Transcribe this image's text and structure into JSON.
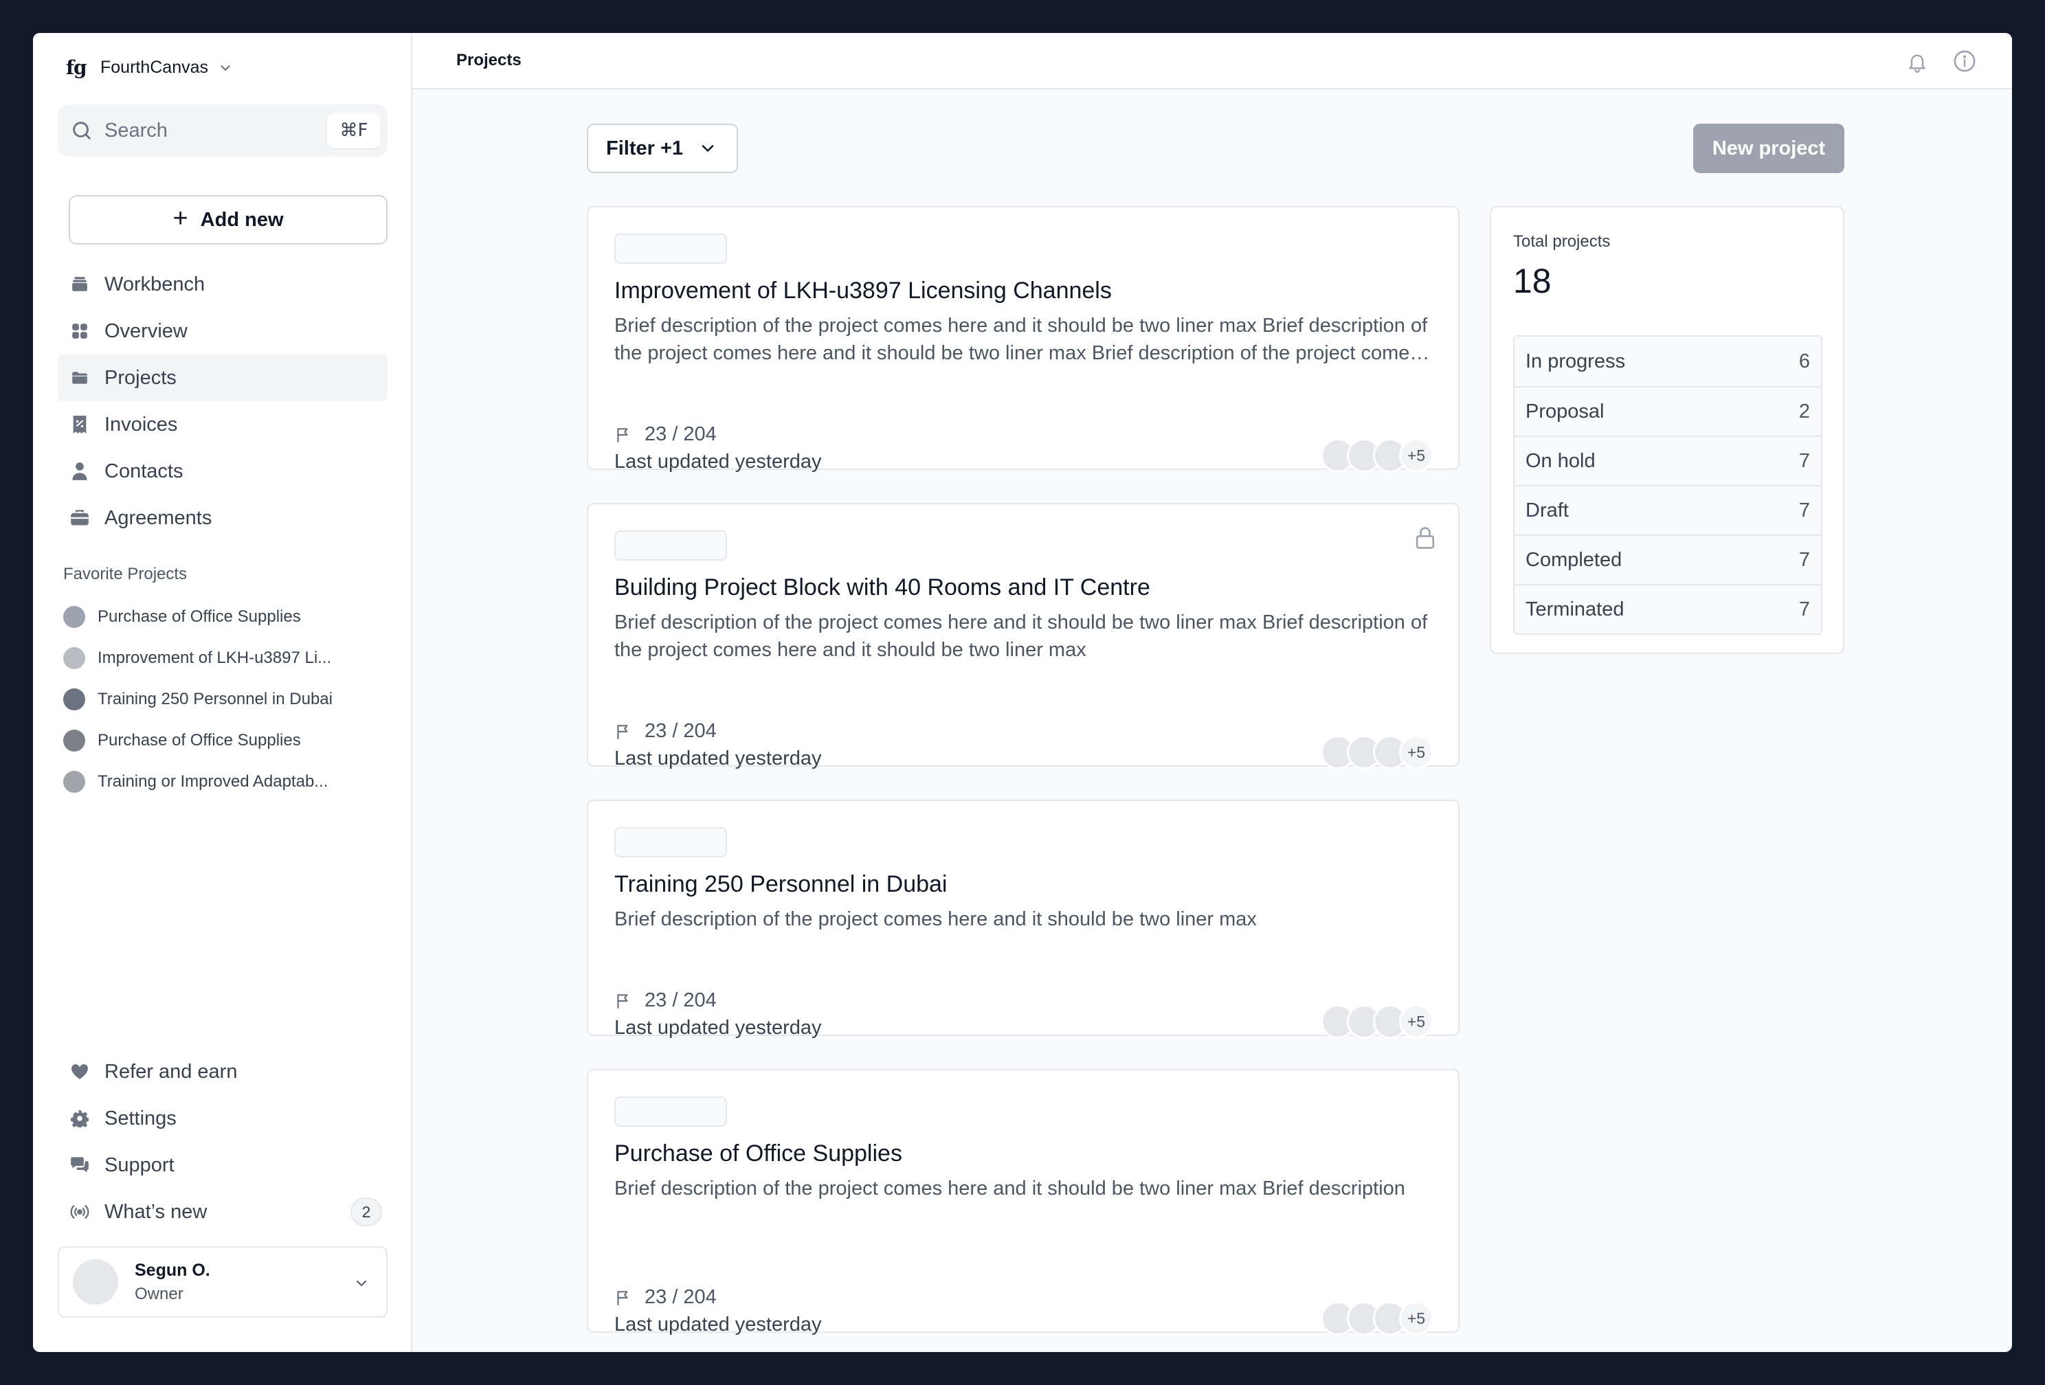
{
  "workspace": {
    "logo": "fg",
    "name": "FourthCanvas"
  },
  "search": {
    "placeholder": "Search",
    "shortcut": "⌘F"
  },
  "add_new": {
    "label": "Add new"
  },
  "nav": [
    {
      "label": "Workbench",
      "icon": "stack-icon"
    },
    {
      "label": "Overview",
      "icon": "grid-icon"
    },
    {
      "label": "Projects",
      "icon": "folder-icon",
      "active": true
    },
    {
      "label": "Invoices",
      "icon": "receipt-icon"
    },
    {
      "label": "Contacts",
      "icon": "person-icon"
    },
    {
      "label": "Agreements",
      "icon": "briefcase-icon"
    }
  ],
  "favorites": {
    "heading": "Favorite Projects",
    "items": [
      {
        "label": "Purchase of Office Supplies",
        "color": "#9ca3af"
      },
      {
        "label": "Improvement of LKH-u3897 Li...",
        "color": "#b9bcc2"
      },
      {
        "label": "Training 250 Personnel in Dubai",
        "color": "#6b7280"
      },
      {
        "label": "Purchase of Office Supplies",
        "color": "#7d8088"
      },
      {
        "label": "Training or Improved Adaptab...",
        "color": "#a1a4aa"
      }
    ]
  },
  "bottom_nav": [
    {
      "label": "Refer and earn",
      "icon": "heart-icon"
    },
    {
      "label": "Settings",
      "icon": "gear-icon"
    },
    {
      "label": "Support",
      "icon": "chat-icon"
    },
    {
      "label": "What’s new",
      "icon": "broadcast-icon",
      "badge": "2"
    }
  ],
  "user": {
    "name": "Segun O.",
    "role": "Owner"
  },
  "topbar": {
    "title": "Projects"
  },
  "toolbar": {
    "filter_label": "Filter +1",
    "new_project_label": "New project"
  },
  "projects": [
    {
      "title": "Improvement of LKH-u3897 Licensing Channels",
      "description": "Brief description of the project comes here and it should be two liner max Brief description of the project comes here and it should be two liner max Brief description of the project comes here and it should be two liner max",
      "progress": "23 / 204",
      "updated": "Last updated yesterday",
      "more": "+5",
      "locked": false
    },
    {
      "title": "Building Project Block with 40 Rooms and IT Centre",
      "description": "Brief description of the project comes here and it should be two liner max Brief description of the project comes here and it should be two liner max",
      "progress": "23 / 204",
      "updated": "Last updated yesterday",
      "more": "+5",
      "locked": true
    },
    {
      "title": "Training 250 Personnel in Dubai",
      "description": "Brief description of the project comes here and it should be two liner max",
      "progress": "23 / 204",
      "updated": "Last updated yesterday",
      "more": "+5",
      "locked": false
    },
    {
      "title": "Purchase of Office Supplies",
      "description": "Brief description of the project comes here and it should be two liner max Brief description",
      "progress": "23 / 204",
      "updated": "Last updated yesterday",
      "more": "+5",
      "locked": false
    }
  ],
  "stats": {
    "label": "Total projects",
    "total": "18",
    "rows": [
      {
        "label": "In progress",
        "count": "6"
      },
      {
        "label": "Proposal",
        "count": "2"
      },
      {
        "label": "On hold",
        "count": "7"
      },
      {
        "label": "Draft",
        "count": "7"
      },
      {
        "label": "Completed",
        "count": "7"
      },
      {
        "label": "Terminated",
        "count": "7"
      }
    ]
  }
}
